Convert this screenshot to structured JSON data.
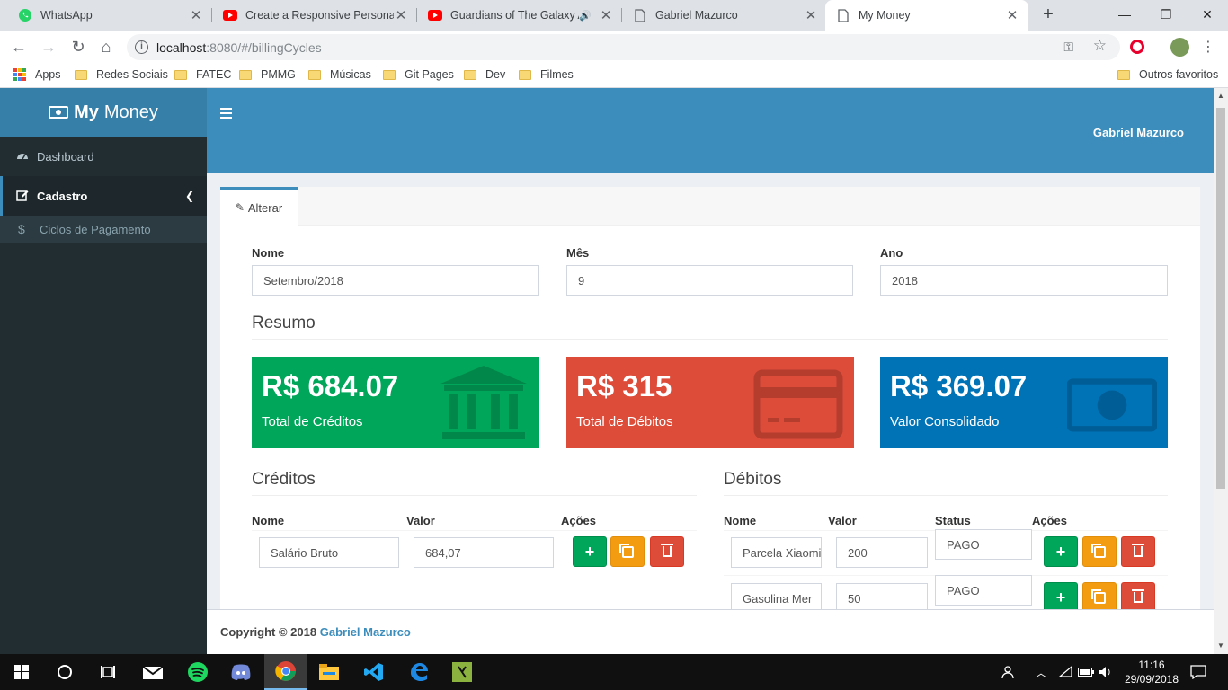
{
  "browser": {
    "tabs": [
      {
        "title": "WhatsApp",
        "icon": "whatsapp-icon",
        "color": "#25d366"
      },
      {
        "title": "Create a Responsive Personal P",
        "icon": "youtube-icon",
        "color": "#ff0000"
      },
      {
        "title": "Guardians of The Galaxy A",
        "icon": "youtube-icon",
        "color": "#ff0000"
      },
      {
        "title": "Gabriel Mazurco",
        "icon": "page-icon",
        "color": "#5f6368"
      },
      {
        "title": "My Money",
        "icon": "page-icon",
        "color": "#5f6368"
      }
    ],
    "url_host": "localhost",
    "url_rest": ":8080/#/billingCycles",
    "bookmarks": [
      "Apps",
      "Redes Sociais",
      "FATEC",
      "PMMG",
      "Músicas",
      "Git Pages",
      "Dev",
      "Filmes"
    ],
    "other_bookmarks": "Outros favoritos"
  },
  "app": {
    "logo_bold": "My",
    "logo_text": "Money",
    "user_name": "Gabriel Mazurco",
    "sidebar": {
      "dashboard": "Dashboard",
      "cadastro": "Cadastro",
      "ciclos": "Ciclos de Pagamento"
    },
    "tab_label": "Alterar",
    "form": {
      "nome_label": "Nome",
      "nome_value": "Setembro/2018",
      "mes_label": "Mês",
      "mes_value": "9",
      "ano_label": "Ano",
      "ano_value": "2018"
    },
    "resumo_title": "Resumo",
    "summary": {
      "credits_value": "R$ 684.07",
      "credits_label": "Total de Créditos",
      "debts_value": "R$ 315",
      "debts_label": "Total de Débitos",
      "total_value": "R$ 369.07",
      "total_label": "Valor Consolidado"
    },
    "credits": {
      "title": "Créditos",
      "headers": {
        "nome": "Nome",
        "valor": "Valor",
        "acoes": "Ações"
      },
      "rows": [
        {
          "nome": "Salário Bruto",
          "valor": "684,07"
        }
      ]
    },
    "debts": {
      "title": "Débitos",
      "headers": {
        "nome": "Nome",
        "valor": "Valor",
        "status": "Status",
        "acoes": "Ações"
      },
      "rows": [
        {
          "nome": "Parcela Xiaomi",
          "valor": "200",
          "status": "PAGO"
        },
        {
          "nome": "Gasolina Mer",
          "valor": "50",
          "status": "PAGO"
        }
      ]
    },
    "footer": {
      "prefix": "Copyright © 2018",
      "author": "Gabriel Mazurco"
    }
  },
  "taskbar": {
    "time": "11:16",
    "date": "29/09/2018"
  },
  "colors": {
    "primary": "#3c8dbc",
    "sidebar": "#222d32",
    "green": "#00a65a",
    "red": "#dd4b39",
    "blue": "#0073b7",
    "orange": "#f39c12"
  }
}
